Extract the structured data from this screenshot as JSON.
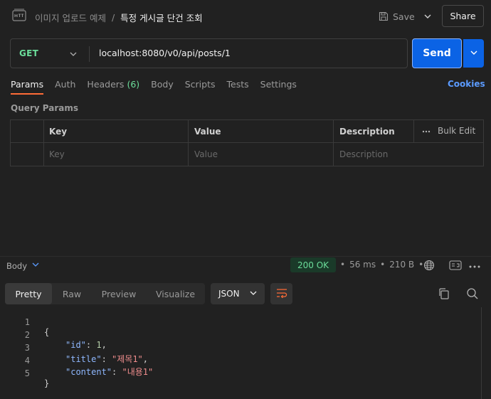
{
  "header": {
    "icon": "http-icon",
    "breadcrumb_parent": "이미지 업로드 예제",
    "breadcrumb_sep": "/",
    "breadcrumb_current": "특정 게시글 단건 조회",
    "save_label": "Save",
    "share_label": "Share"
  },
  "request": {
    "method": "GET",
    "url": "localhost:8080/v0/api/posts/1",
    "send_label": "Send"
  },
  "tabs": [
    {
      "label": "Params",
      "active": true
    },
    {
      "label": "Auth"
    },
    {
      "label": "Headers",
      "count": "(6)"
    },
    {
      "label": "Body"
    },
    {
      "label": "Scripts"
    },
    {
      "label": "Tests"
    },
    {
      "label": "Settings"
    }
  ],
  "cookies_label": "Cookies",
  "query_params": {
    "title": "Query Params",
    "headers": {
      "key": "Key",
      "value": "Value",
      "description": "Description",
      "bulk_edit": "Bulk Edit"
    },
    "placeholders": {
      "key": "Key",
      "value": "Value",
      "description": "Description"
    }
  },
  "response": {
    "body_label": "Body",
    "status": "200 OK",
    "time": "56 ms",
    "dot": "•",
    "size": "210 B",
    "view_tabs": [
      {
        "label": "Pretty",
        "active": true
      },
      {
        "label": "Raw"
      },
      {
        "label": "Preview"
      },
      {
        "label": "Visualize"
      }
    ],
    "format": "JSON",
    "lines": [
      {
        "num": "1",
        "text": "{"
      },
      {
        "num": "2",
        "key": "\"id\"",
        "value": "1",
        "type": "number",
        "trail": ","
      },
      {
        "num": "3",
        "key": "\"title\"",
        "value": "\"제목1\"",
        "type": "string",
        "trail": ","
      },
      {
        "num": "4",
        "key": "\"content\"",
        "value": "\"내용1\"",
        "type": "string",
        "trail": ""
      },
      {
        "num": "5",
        "text": "}"
      }
    ]
  },
  "colors": {
    "accent": "#ff6c37",
    "send": "#0b63e5",
    "method_get": "#6bdd9a",
    "status_ok": "#6bdd9a",
    "link": "#5b9bff"
  }
}
